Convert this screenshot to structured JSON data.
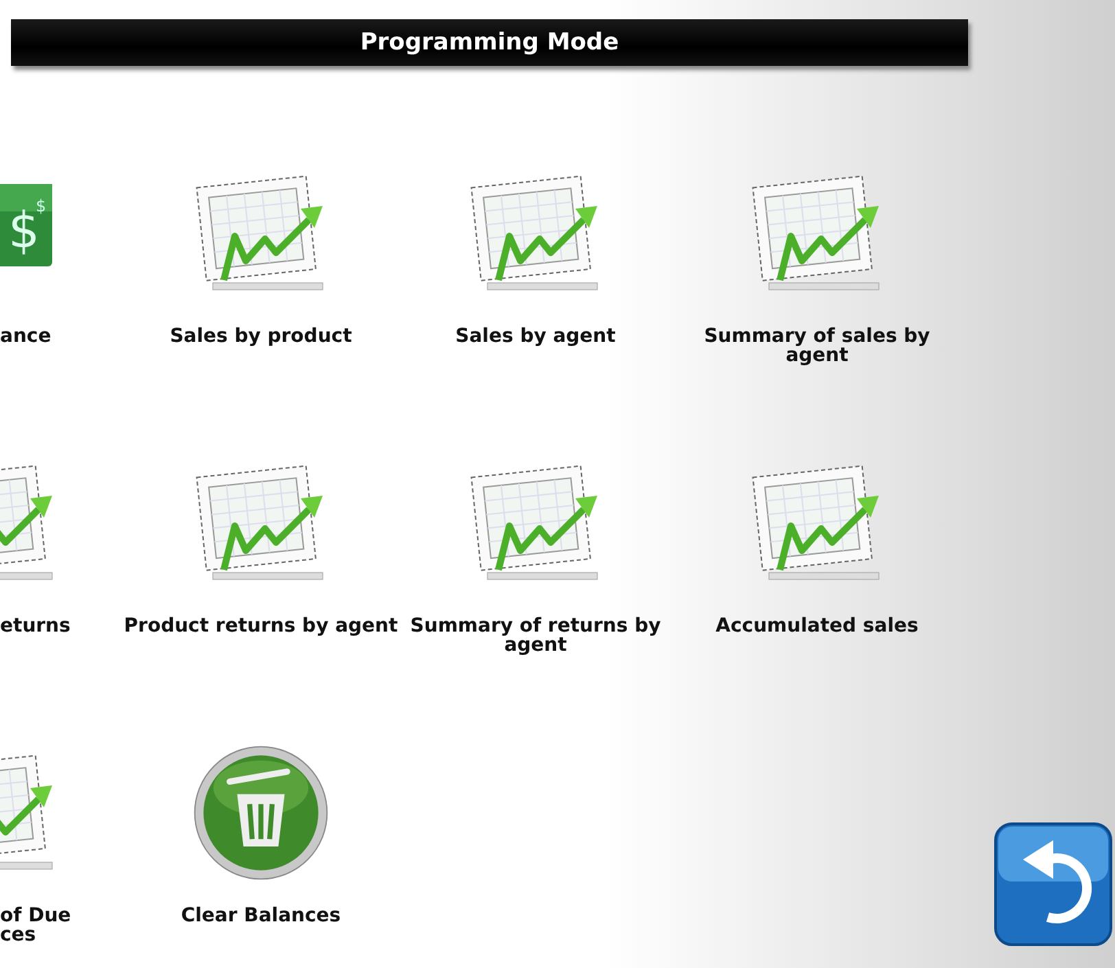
{
  "title_bar": {
    "title": "Programming Mode"
  },
  "tiles": [
    {
      "kind": "money",
      "label": "ance",
      "symbols": [
        "$",
        "$"
      ]
    },
    {
      "kind": "chart",
      "label": "Sales by product"
    },
    {
      "kind": "chart",
      "label": "Sales by agent"
    },
    {
      "kind": "chart",
      "label": "Summary of sales by agent"
    },
    {
      "kind": "chart",
      "label": "eturns"
    },
    {
      "kind": "chart",
      "label": "Product returns by agent"
    },
    {
      "kind": "chart",
      "label": "Summary of returns by agent"
    },
    {
      "kind": "chart",
      "label": "Accumulated sales"
    },
    {
      "kind": "chart",
      "label": "of Due ces"
    },
    {
      "kind": "trash",
      "label": "Clear Balances"
    }
  ],
  "back_button": {
    "kind": "undo"
  }
}
